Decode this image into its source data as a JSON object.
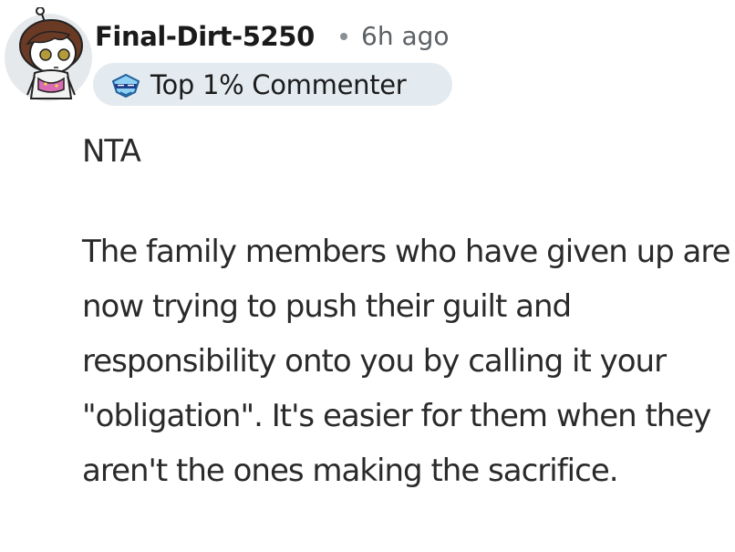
{
  "comment": {
    "author": "Final-Dirt-5250",
    "separator": "•",
    "timestamp": "6h ago",
    "badge": {
      "icon": "top-commenter-gem-icon",
      "label": "Top 1% Commenter"
    },
    "paragraphs": [
      "NTA",
      "The family members who have given up are now trying to push their guilt and responsibility onto you by calling it your \"obligation\". It's easier for them when they aren't the ones making the sacrifice."
    ]
  },
  "colors": {
    "username": "#1a1a1b",
    "timestamp": "#5c6166",
    "badge_background": "#e4ebf0",
    "body_text": "#2a2a2a",
    "avatar_background": "#e5e9ec"
  }
}
